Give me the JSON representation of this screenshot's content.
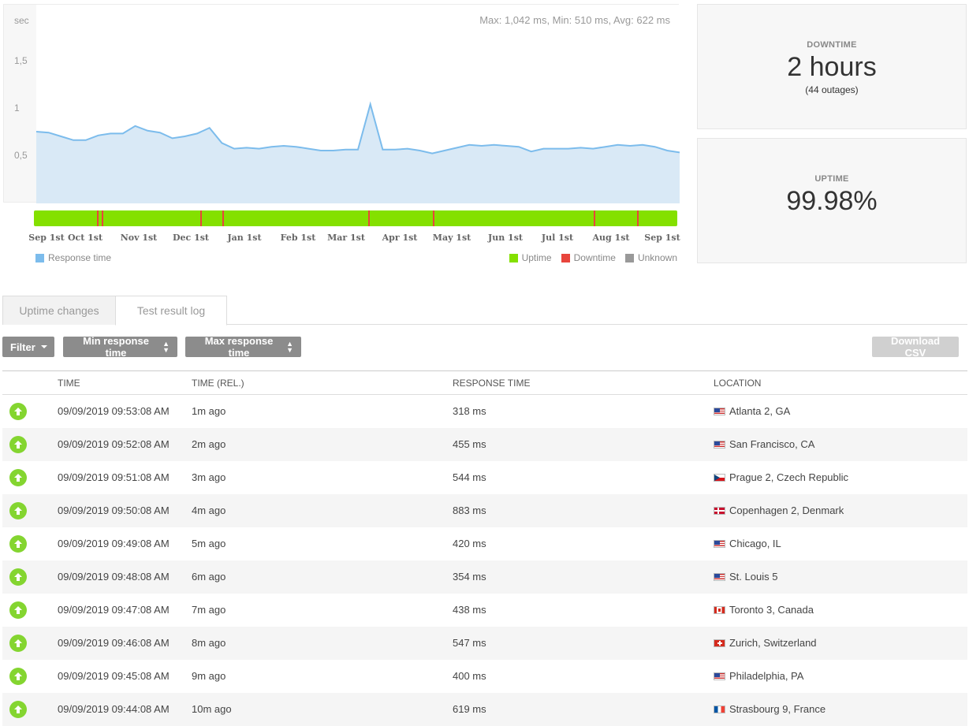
{
  "chart_data": {
    "type": "area",
    "series": [
      {
        "values": [
          0.75,
          0.74,
          0.7,
          0.66,
          0.66,
          0.71,
          0.73,
          0.73,
          0.81,
          0.76,
          0.74,
          0.68,
          0.7,
          0.73,
          0.79,
          0.63,
          0.57,
          0.58,
          0.57,
          0.59,
          0.6,
          0.59,
          0.57,
          0.55,
          0.55,
          0.56,
          0.56,
          1.04,
          0.56,
          0.56,
          0.57,
          0.55,
          0.52,
          0.55,
          0.58,
          0.61,
          0.6,
          0.61,
          0.6,
          0.59,
          0.54,
          0.57,
          0.57,
          0.57,
          0.58,
          0.57,
          0.59,
          0.61,
          0.6,
          0.61,
          0.59,
          0.55,
          0.53
        ]
      }
    ],
    "y_unit": "sec",
    "y_ticks": [
      "1,5",
      "1",
      "0,5"
    ],
    "ylim": [
      0,
      1.7
    ],
    "stats": "Max: 1,042 ms, Min: 510 ms, Avg: 622 ms",
    "x_ticks": [
      "Sep 1st",
      "Oct 1st",
      "Nov 1st",
      "Dec 1st",
      "Jan 1st",
      "Feb 1st",
      "Mar 1st",
      "Apr 1st",
      "May 1st",
      "Jun 1st",
      "Jul 1st",
      "Aug 1st",
      "Sep 1st"
    ],
    "downtime_marks_fraction": [
      0.098,
      0.105,
      0.258,
      0.293,
      0.52,
      0.62,
      0.87,
      0.938
    ],
    "legend": {
      "response_time": "Response time",
      "uptime": "Uptime",
      "downtime": "Downtime",
      "unknown": "Unknown"
    },
    "colors": {
      "line": "#7cbcec",
      "area": "#d9e9f6",
      "uptime": "#84e000",
      "downtime": "#e8453c",
      "unknown": "#999999"
    }
  },
  "downtime_card": {
    "caption": "DOWNTIME",
    "value": "2 hours",
    "sub": "(44 outages)"
  },
  "uptime_card": {
    "caption": "UPTIME",
    "value": "99.98%"
  },
  "tabs": {
    "uptime_changes": "Uptime changes",
    "test_result_log": "Test result log"
  },
  "toolbar": {
    "filter": "Filter",
    "min_response": "Min response time",
    "max_response": "Max response time",
    "download_csv": "Download CSV"
  },
  "table": {
    "headers": {
      "time": "TIME",
      "time_rel": "TIME (REL.)",
      "response": "RESPONSE TIME",
      "location": "LOCATION"
    },
    "rows": [
      {
        "time": "09/09/2019 09:53:08 AM",
        "rel": "1m ago",
        "resp": "318 ms",
        "loc": "Atlanta 2, GA",
        "flag": "us"
      },
      {
        "time": "09/09/2019 09:52:08 AM",
        "rel": "2m ago",
        "resp": "455 ms",
        "loc": "San Francisco, CA",
        "flag": "us"
      },
      {
        "time": "09/09/2019 09:51:08 AM",
        "rel": "3m ago",
        "resp": "544 ms",
        "loc": "Prague 2, Czech Republic",
        "flag": "cz"
      },
      {
        "time": "09/09/2019 09:50:08 AM",
        "rel": "4m ago",
        "resp": "883 ms",
        "loc": "Copenhagen 2, Denmark",
        "flag": "dk"
      },
      {
        "time": "09/09/2019 09:49:08 AM",
        "rel": "5m ago",
        "resp": "420 ms",
        "loc": "Chicago, IL",
        "flag": "us"
      },
      {
        "time": "09/09/2019 09:48:08 AM",
        "rel": "6m ago",
        "resp": "354 ms",
        "loc": "St. Louis 5",
        "flag": "us"
      },
      {
        "time": "09/09/2019 09:47:08 AM",
        "rel": "7m ago",
        "resp": "438 ms",
        "loc": "Toronto 3, Canada",
        "flag": "ca"
      },
      {
        "time": "09/09/2019 09:46:08 AM",
        "rel": "8m ago",
        "resp": "547 ms",
        "loc": "Zurich, Switzerland",
        "flag": "ch"
      },
      {
        "time": "09/09/2019 09:45:08 AM",
        "rel": "9m ago",
        "resp": "400 ms",
        "loc": "Philadelphia, PA",
        "flag": "us"
      },
      {
        "time": "09/09/2019 09:44:08 AM",
        "rel": "10m ago",
        "resp": "619 ms",
        "loc": "Strasbourg 9, France",
        "flag": "fr"
      }
    ]
  }
}
